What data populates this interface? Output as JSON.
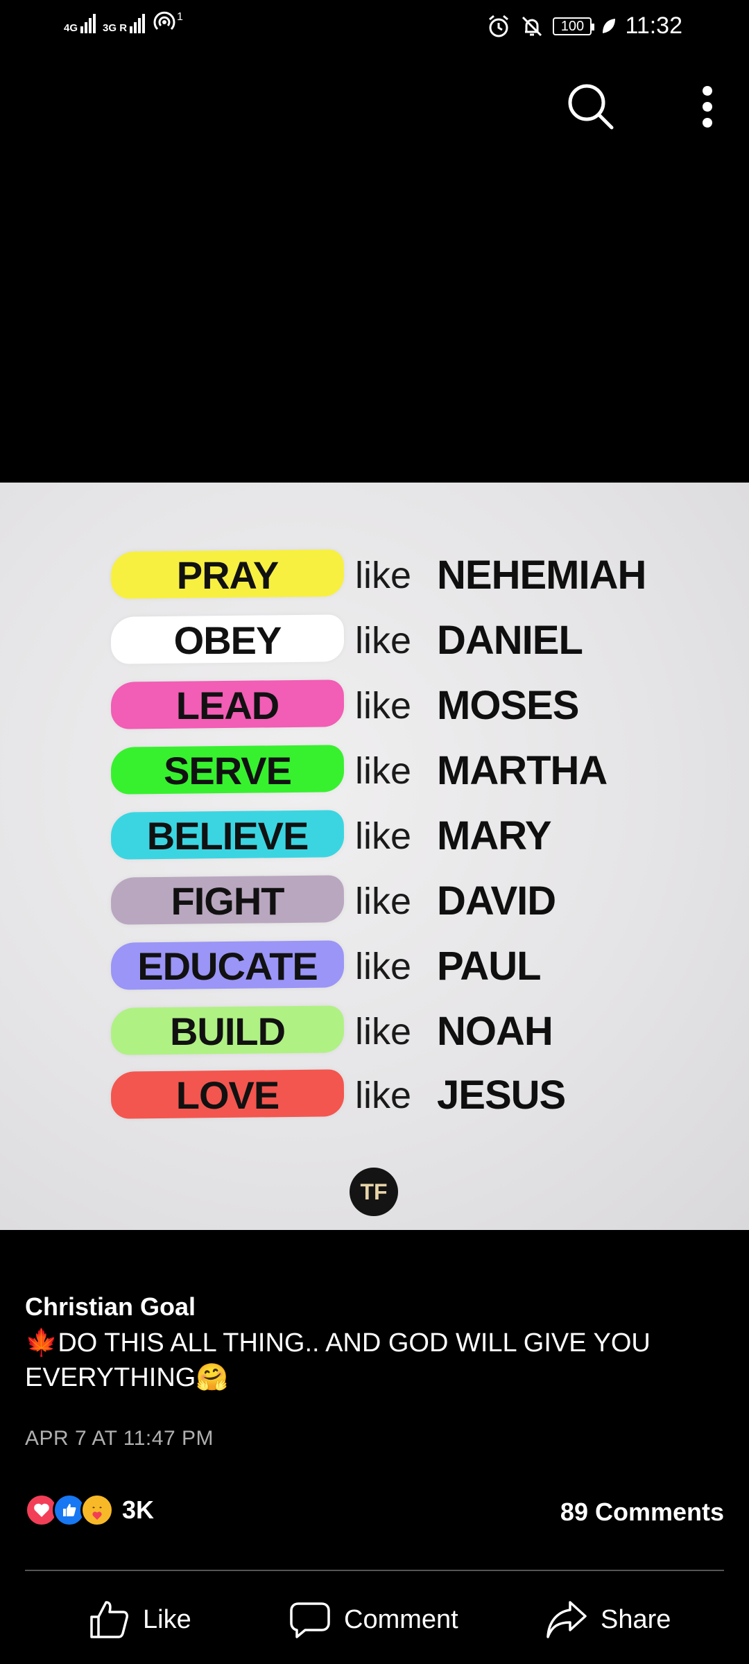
{
  "status_bar": {
    "net1": "4G",
    "net2": "3G R",
    "hotspot_badge": "1",
    "battery": "100",
    "time": "11:32"
  },
  "post_image": {
    "rows": [
      {
        "verb": "PRAY",
        "like": "like",
        "who": "NEHEMIAH",
        "color": "#f7f041"
      },
      {
        "verb": "OBEY",
        "like": "like",
        "who": "DANIEL",
        "color": "#ffffff"
      },
      {
        "verb": "LEAD",
        "like": "like",
        "who": "MOSES",
        "color": "#f25db5"
      },
      {
        "verb": "SERVE",
        "like": "like",
        "who": "MARTHA",
        "color": "#37f12f"
      },
      {
        "verb": "BELIEVE",
        "like": "like",
        "who": "MARY",
        "color": "#3bd5e2"
      },
      {
        "verb": "FIGHT",
        "like": "like",
        "who": "DAVID",
        "color": "#b9a7bf"
      },
      {
        "verb": "EDUCATE",
        "like": "like",
        "who": "PAUL",
        "color": "#9a95f6"
      },
      {
        "verb": "BUILD",
        "like": "like",
        "who": "NOAH",
        "color": "#b0f184"
      },
      {
        "verb": "LOVE",
        "like": "like",
        "who": "JESUS",
        "color": "#f3564f"
      }
    ],
    "logo_text": "TF"
  },
  "post": {
    "author": "Christian Goal",
    "caption": "🍁DO THIS ALL THING.. AND GOD WILL GIVE YOU EVERYTHING🤗",
    "timestamp": "APR 7 AT 11:47 PM",
    "reaction_count": "3K",
    "comments": "89 Comments"
  },
  "actions": {
    "like": "Like",
    "comment": "Comment",
    "share": "Share"
  },
  "colors": {
    "background": "#000000",
    "love_reaction": "#f33e58",
    "like_reaction": "#1877f2",
    "care_reaction": "#f7b928"
  }
}
